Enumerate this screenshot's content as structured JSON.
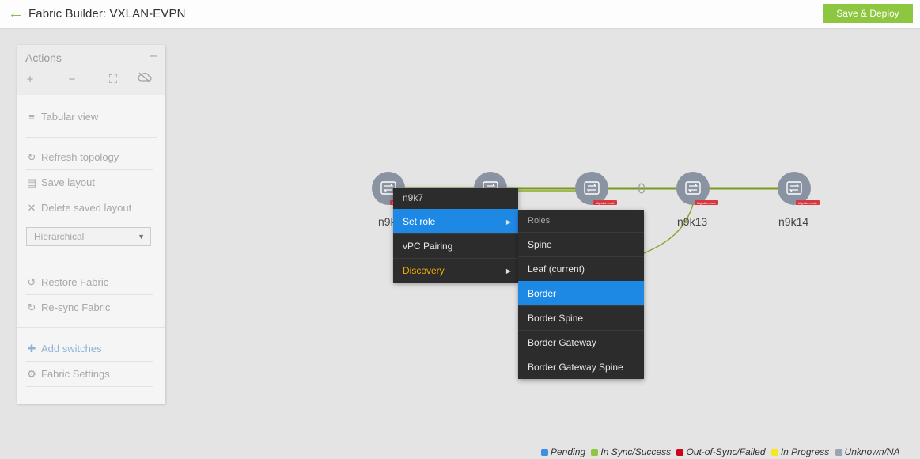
{
  "header": {
    "back_icon": "arrow-left-icon",
    "title": "Fabric Builder: VXLAN-EVPN",
    "save_deploy_label": "Save & Deploy",
    "accent": "#8dc63f"
  },
  "actions": {
    "title": "Actions",
    "collapse_glyph": "–",
    "toolbar": [
      {
        "name": "zoom-in-icon",
        "glyph": "+"
      },
      {
        "name": "zoom-out-icon",
        "glyph": "−"
      },
      {
        "name": "fit-to-screen-icon",
        "glyph": "⛶"
      },
      {
        "name": "cloud-off-icon",
        "glyph": "⌀"
      }
    ],
    "tabular_view": "Tabular view",
    "refresh_topology": "Refresh topology",
    "save_layout": "Save layout",
    "delete_saved_layout": "Delete saved layout",
    "layout_select": "Hierarchical",
    "restore_fabric": "Restore Fabric",
    "resync_fabric": "Re-sync Fabric",
    "add_switches": "Add switches",
    "fabric_settings": "Fabric Settings"
  },
  "topology": {
    "nodes": [
      {
        "label": "n9k"
      },
      {
        "label": ""
      },
      {
        "label": ""
      },
      {
        "label": "n9k13"
      },
      {
        "label": "n9k14"
      }
    ],
    "badge_text": "Migration mode",
    "link_color": "#7a9a1c"
  },
  "context_menu": {
    "header": "n9k7",
    "items": [
      {
        "label": "Set role",
        "has_submenu": true,
        "active": true
      },
      {
        "label": "vPC Pairing",
        "has_submenu": false
      },
      {
        "label": "Discovery",
        "has_submenu": true,
        "highlight": "#f2a900"
      }
    ]
  },
  "role_menu": {
    "header": "Roles",
    "items": [
      "Spine",
      "Leaf (current)",
      "Border",
      "Border Spine",
      "Border Gateway",
      "Border Gateway Spine"
    ],
    "active": "Border"
  },
  "legend": [
    {
      "label": "Pending",
      "color": "#3d8fe0"
    },
    {
      "label": "In Sync/Success",
      "color": "#8dc63f"
    },
    {
      "label": "Out-of-Sync/Failed",
      "color": "#d0021b"
    },
    {
      "label": "In Progress",
      "color": "#f8e71c"
    },
    {
      "label": "Unknown/NA",
      "color": "#9aa5b1"
    }
  ]
}
